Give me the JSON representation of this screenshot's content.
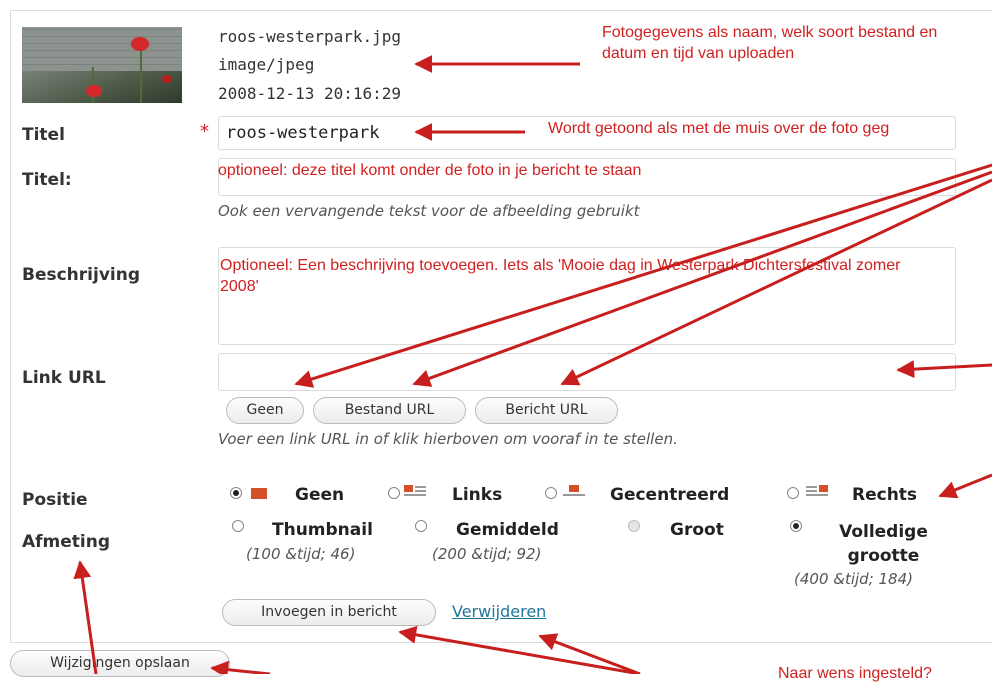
{
  "file": {
    "name": "roos-westerpark.jpg",
    "type": "image/jpeg",
    "date": "2008-12-13 20:16:29"
  },
  "form": {
    "title_label": "Titel",
    "title_required_mark": "*",
    "title_value": "roos-westerpark",
    "caption_label": "Titel:",
    "caption_help": "Ook een vervangende tekst voor de afbeelding gebruikt",
    "description_label": "Beschrijving",
    "link_label": "Link URL",
    "link_buttons": [
      "Geen",
      "Bestand URL",
      "Bericht URL"
    ],
    "link_help": "Voer een link URL in of klik hierboven om vooraf in te stellen.",
    "position_label": "Positie",
    "position_options": [
      "Geen",
      "Links",
      "Gecentreerd",
      "Rechts"
    ],
    "position_selected": "Geen",
    "size_label": "Afmeting",
    "size_options": [
      {
        "label": "Thumbnail",
        "dims": "(100 &tijd; 46)",
        "state": "enabled"
      },
      {
        "label": "Gemiddeld",
        "dims": "(200 &tijd; 92)",
        "state": "enabled"
      },
      {
        "label": "Groot",
        "dims": "",
        "state": "disabled"
      },
      {
        "label": "Volledige grootte",
        "dims": "(400 &tijd; 184)",
        "state": "selected"
      }
    ],
    "insert_button": "Invoegen in bericht",
    "delete_link": "Verwijderen",
    "save_button": "Wijzigingen opslaan"
  },
  "annotations": {
    "file_info": "Fotogegevens als naam, welk soort bestand en datum en tijd van uploaden",
    "title_hover": "Wordt getoond als met de muis over de foto geg",
    "caption_optional": "optioneel: deze titel komt onder de foto in je bericht te staan",
    "description_optional": "Optioneel: Een beschrijving toevoegen. Iets als 'Mooie dag in Westerpark Dichtersfestival zomer 2008'",
    "bottom_right": "Naar wens ingesteld?"
  },
  "colors": {
    "annotation_red": "#d12020",
    "link_blue": "#21759b",
    "field_border": "#dcdcdc"
  },
  "icons": [
    "align-none-icon",
    "align-left-icon",
    "align-center-icon",
    "align-right-icon"
  ]
}
